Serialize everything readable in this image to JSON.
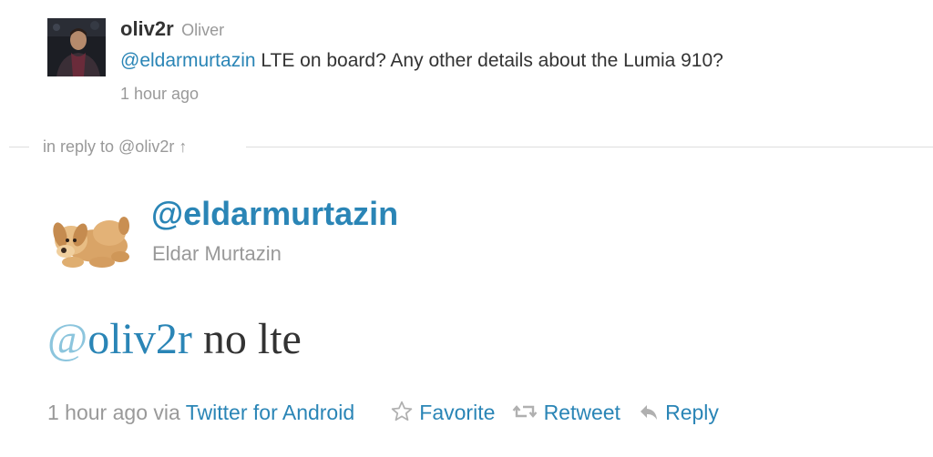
{
  "parent_tweet": {
    "screen_name": "oliv2r",
    "full_name": "Oliver",
    "mention": "@eldarmurtazin",
    "text": " LTE on board? Any other details about the Lumia 910?",
    "timestamp": "1 hour ago"
  },
  "reply_divider": {
    "text": "in reply to @oliv2r ↑"
  },
  "main_tweet": {
    "screen_name": "@eldarmurtazin",
    "full_name": "Eldar Murtazin",
    "mention_at": "@",
    "mention_handle": "oliv2r",
    "text": " no lte",
    "timestamp": "1 hour ago",
    "via": "via",
    "source": "Twitter for Android"
  },
  "actions": {
    "favorite_label": "Favorite",
    "retweet_label": "Retweet",
    "reply_label": "Reply",
    "favorite_icon": "star-icon",
    "retweet_icon": "retweet-icon",
    "reply_icon": "reply-arrow-icon"
  },
  "colors": {
    "link": "#2a85b6",
    "muted": "#999999",
    "text": "#333333",
    "at_sign_light": "#8cc5dd"
  }
}
